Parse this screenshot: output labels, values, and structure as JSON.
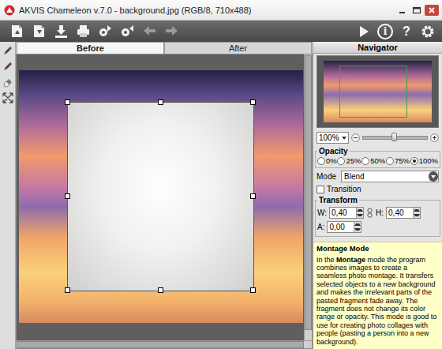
{
  "window": {
    "title": "AKVIS Chameleon v.7.0 - background.jpg (RGB/8, 710x488)"
  },
  "toolbar": {
    "info_glyph": "i",
    "help_glyph": "?"
  },
  "tabs": [
    {
      "label": "Before",
      "selected": true
    },
    {
      "label": "After",
      "selected": false
    }
  ],
  "canvas": {
    "h_scroll_level": 0.97,
    "v_scroll_level": 0.96
  },
  "navigator": {
    "title": "Navigator",
    "zoom": "100%",
    "zoom_level": 0.5
  },
  "opacity": {
    "title": "Opacity",
    "options": [
      {
        "label": "0%",
        "selected": false
      },
      {
        "label": "25%",
        "selected": false
      },
      {
        "label": "50%",
        "selected": false
      },
      {
        "label": "75%",
        "selected": false
      },
      {
        "label": "100%",
        "selected": true
      }
    ]
  },
  "mode": {
    "label": "Mode",
    "value": "Blend"
  },
  "transition": {
    "label": "Transition",
    "checked": false
  },
  "transform": {
    "title": "Transform",
    "fields": [
      {
        "label": "W:",
        "value": "0,40"
      },
      {
        "label": "H:",
        "value": "0,40"
      },
      {
        "label": "A:",
        "value": "0,00"
      }
    ]
  },
  "help": {
    "title": "Montage Mode",
    "parts": [
      {
        "text": "In the ",
        "bold": false
      },
      {
        "text": "Montage",
        "bold": true
      },
      {
        "text": " mode the program combines images to create a seamless photo montage. It transfers selected objects to a new background and makes the irrelevant parts of the pasted fragment fade away. The fragment does not change its color range or opacity. This mode is good to use for creating photo collages with people (pasting a person into a new background).",
        "bold": false
      }
    ]
  }
}
